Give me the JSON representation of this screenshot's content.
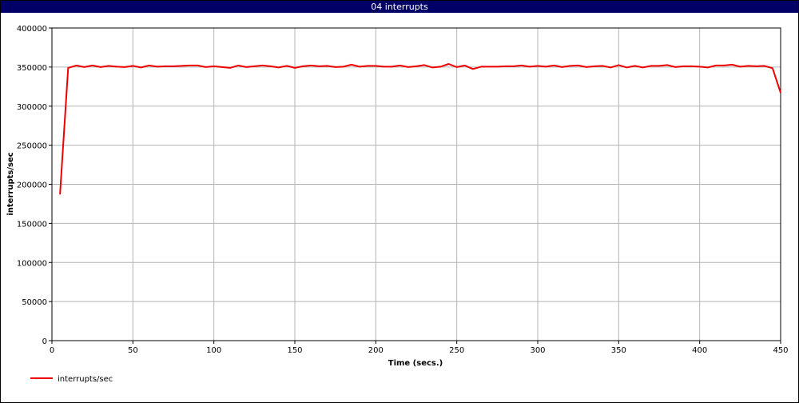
{
  "window": {
    "title": "04 interrupts"
  },
  "chart_data": {
    "type": "line",
    "title": "04 interrupts",
    "xlabel": "Time (secs.)",
    "ylabel": "interrupts/sec",
    "xlim": [
      0,
      450
    ],
    "ylim": [
      0,
      400000
    ],
    "x_ticks": [
      0,
      50,
      100,
      150,
      200,
      250,
      300,
      350,
      400,
      450
    ],
    "y_ticks": [
      0,
      50000,
      100000,
      150000,
      200000,
      250000,
      300000,
      350000,
      400000
    ],
    "grid": true,
    "legend_position": "bottom-left",
    "series": [
      {
        "name": "interrupts/sec",
        "color": "#ee0000",
        "x": [
          5,
          10,
          15,
          20,
          25,
          30,
          35,
          40,
          45,
          50,
          55,
          60,
          65,
          70,
          75,
          80,
          85,
          90,
          95,
          100,
          105,
          110,
          115,
          120,
          125,
          130,
          135,
          140,
          145,
          150,
          155,
          160,
          165,
          170,
          175,
          180,
          185,
          190,
          195,
          200,
          205,
          210,
          215,
          220,
          225,
          230,
          235,
          240,
          245,
          250,
          255,
          260,
          265,
          270,
          275,
          280,
          285,
          290,
          295,
          300,
          305,
          310,
          315,
          320,
          325,
          330,
          335,
          340,
          345,
          350,
          355,
          360,
          365,
          370,
          375,
          380,
          385,
          390,
          395,
          400,
          405,
          410,
          415,
          420,
          425,
          430,
          435,
          440,
          445,
          450
        ],
        "y": [
          187000,
          349000,
          352000,
          350000,
          352000,
          350000,
          351500,
          350500,
          350000,
          351500,
          349500,
          352000,
          350500,
          351000,
          351000,
          351500,
          352000,
          352000,
          350000,
          351000,
          350000,
          349000,
          352000,
          350000,
          351000,
          352000,
          351000,
          349500,
          351500,
          349000,
          351000,
          352000,
          351000,
          351500,
          350000,
          350500,
          353000,
          350500,
          351500,
          351500,
          350500,
          350500,
          352000,
          350000,
          351000,
          352500,
          349500,
          350500,
          354000,
          350000,
          352000,
          347500,
          350500,
          350500,
          350500,
          351000,
          351000,
          352000,
          350500,
          351500,
          350500,
          352000,
          350000,
          351500,
          352000,
          350000,
          351000,
          351500,
          349500,
          352500,
          349500,
          351500,
          349500,
          351500,
          351500,
          352500,
          350000,
          351000,
          351000,
          350500,
          349500,
          352000,
          352000,
          353000,
          350500,
          351500,
          351000,
          351500,
          348500,
          317000
        ]
      }
    ]
  }
}
